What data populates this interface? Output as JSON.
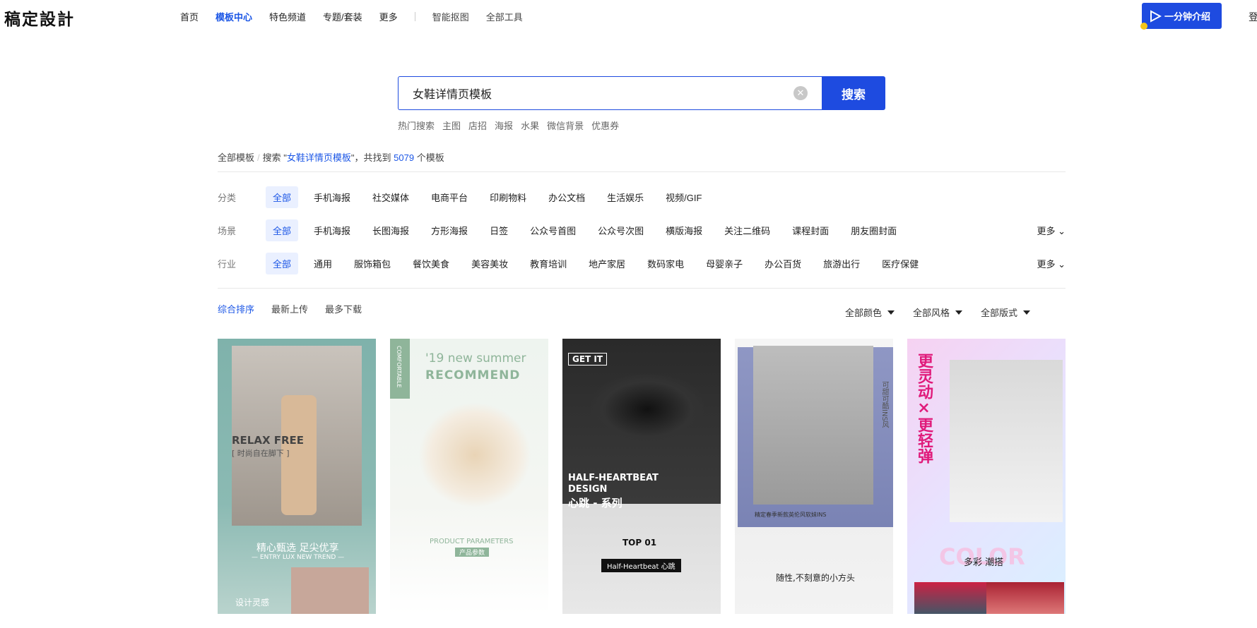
{
  "header": {
    "logo": "稿定設計",
    "nav": [
      "首页",
      "模板中心",
      "特色频道",
      "专题/套装",
      "更多"
    ],
    "nav_tools": [
      "智能抠图",
      "全部工具"
    ],
    "intro_label": "一分钟介绍",
    "login_label": "登"
  },
  "search": {
    "value": "女鞋详情页模板",
    "button": "搜索",
    "hot_label": "热门搜索",
    "hot_tags": [
      "主图",
      "店招",
      "海报",
      "水果",
      "微信背景",
      "优惠券"
    ]
  },
  "breadcrumb": {
    "all": "全部模板",
    "search_prefix": "搜索 \"",
    "keyword": "女鞋详情页模板",
    "middle": "\"，共找到",
    "count": "5079",
    "suffix": "个模板"
  },
  "filters": {
    "category": {
      "label": "分类",
      "options": [
        "全部",
        "手机海报",
        "社交媒体",
        "电商平台",
        "印刷物料",
        "办公文档",
        "生活娱乐",
        "视频/GIF"
      ]
    },
    "scene": {
      "label": "场景",
      "options": [
        "全部",
        "手机海报",
        "长图海报",
        "方形海报",
        "日签",
        "公众号首图",
        "公众号次图",
        "横版海报",
        "关注二维码",
        "课程封面",
        "朋友圈封面"
      ],
      "more": "更多"
    },
    "industry": {
      "label": "行业",
      "options": [
        "全部",
        "通用",
        "服饰箱包",
        "餐饮美食",
        "美容美妆",
        "教育培训",
        "地产家居",
        "数码家电",
        "母婴亲子",
        "办公百货",
        "旅游出行",
        "医疗保健"
      ],
      "more": "更多"
    }
  },
  "sort": {
    "options": [
      "综合排序",
      "最新上传",
      "最多下载"
    ],
    "dropdowns": [
      "全部颜色",
      "全部风格",
      "全部版式"
    ]
  },
  "cards": [
    {
      "lines": [
        "RELAX FREE",
        "[ 时尚自在脚下 ]",
        "精心甄选 足尖优享",
        "— ENTRY LUX NEW TREND —",
        "设计灵感"
      ]
    },
    {
      "lines": [
        "COMFORTABLE",
        "'19 new summer",
        "RECOMMEND",
        "PRODUCT PARAMETERS",
        "产品参数"
      ]
    },
    {
      "lines": [
        "GET IT",
        "HALF-HEARTBEAT",
        "DESIGN",
        "心跳 - 系列",
        "TOP 01",
        "Half-Heartbeat 心跳"
      ]
    },
    {
      "lines": [
        "可甜可酷INS风",
        "精定春季新款英伦风软妹INS",
        "随性,不刻意的小方头"
      ]
    },
    {
      "lines": [
        "更灵动×更轻弹",
        "COLOR",
        "多彩 潮搭"
      ]
    }
  ],
  "colors": {
    "accent": "#1e4be0",
    "link": "#1b56e6"
  }
}
